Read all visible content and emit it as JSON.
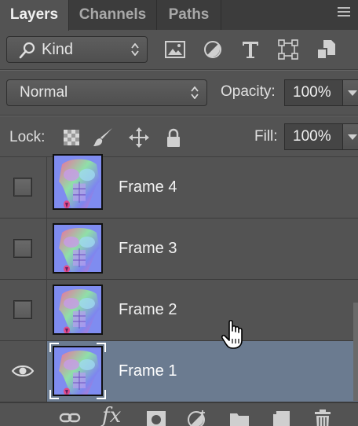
{
  "tabs": [
    {
      "label": "Layers",
      "active": true
    },
    {
      "label": "Channels",
      "active": false
    },
    {
      "label": "Paths",
      "active": false
    }
  ],
  "filter": {
    "kind_label": "Kind",
    "icons": [
      "image-filter-icon",
      "adjustment-filter-icon",
      "type-filter-icon",
      "shape-filter-icon",
      "smart-object-filter-icon"
    ]
  },
  "blend": {
    "mode": "Normal",
    "opacity_label": "Opacity:",
    "opacity_value": "100%"
  },
  "lock": {
    "label": "Lock:",
    "icons": [
      "lock-transparent-icon",
      "lock-image-icon",
      "lock-position-icon",
      "lock-all-icon"
    ],
    "fill_label": "Fill:",
    "fill_value": "100%"
  },
  "layers": [
    {
      "name": "Frame 4",
      "visible": false,
      "selected": false
    },
    {
      "name": "Frame 3",
      "visible": false,
      "selected": false
    },
    {
      "name": "Frame 2",
      "visible": false,
      "selected": false
    },
    {
      "name": "Frame 1",
      "visible": true,
      "selected": true
    }
  ],
  "bottom_icons": [
    "link-layers-icon",
    "fx-icon",
    "add-mask-icon",
    "adjustment-layer-icon",
    "new-group-icon",
    "new-layer-icon",
    "delete-layer-icon"
  ],
  "bottom_fx_label": "fx",
  "colors": {
    "panel": "#535353",
    "tabbar": "#3c3c3c",
    "selected_layer": "#6b7b90"
  }
}
